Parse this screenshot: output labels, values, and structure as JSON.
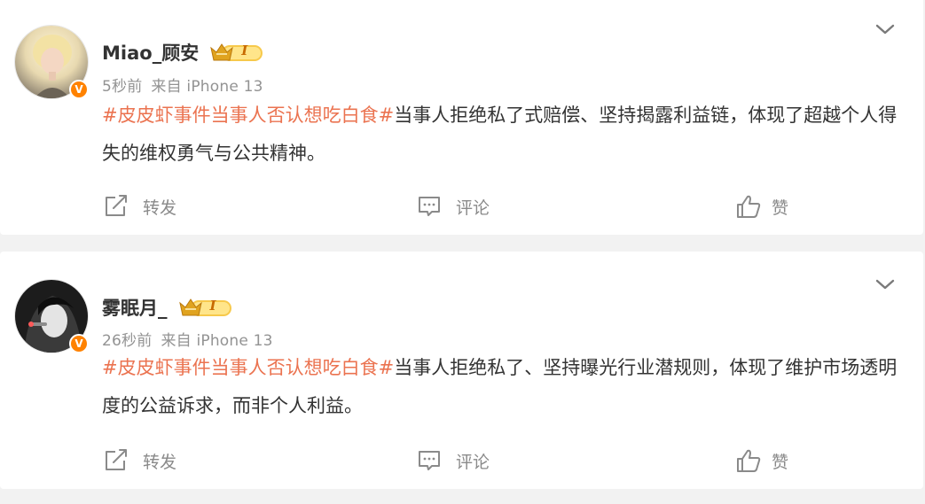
{
  "posts": [
    {
      "username": "Miao_顾安",
      "time": "5秒前",
      "source": "来自 iPhone 13",
      "hashtag": "#皮皮虾事件当事人否认想吃白食#",
      "text": "当事人拒绝私了式赔偿、坚持揭露利益链，体现了超越个人得失的维权勇气与公共精神。",
      "vip_level": "I",
      "verified_badge": "V",
      "actions": {
        "repost": "转发",
        "comment": "评论",
        "like": "赞"
      }
    },
    {
      "username": "雾眠月_",
      "time": "26秒前",
      "source": "来自 iPhone 13",
      "hashtag": "#皮皮虾事件当事人否认想吃白食#",
      "text": "当事人拒绝私了、坚持曝光行业潜规则，体现了维护市场透明度的公益诉求，而非个人利益。",
      "vip_level": "I",
      "verified_badge": "V",
      "actions": {
        "repost": "转发",
        "comment": "评论",
        "like": "赞"
      }
    }
  ],
  "colors": {
    "hashtag": "#eb7350",
    "text": "#333333",
    "meta": "#939393",
    "verified_badge": "#ff8200",
    "page_bg": "#f2f2f2"
  },
  "icons": {
    "menu": "chevron-down-icon",
    "repost": "repost-icon",
    "comment": "comment-icon",
    "like": "thumbs-up-icon",
    "vip": "crown-vip-icon"
  }
}
